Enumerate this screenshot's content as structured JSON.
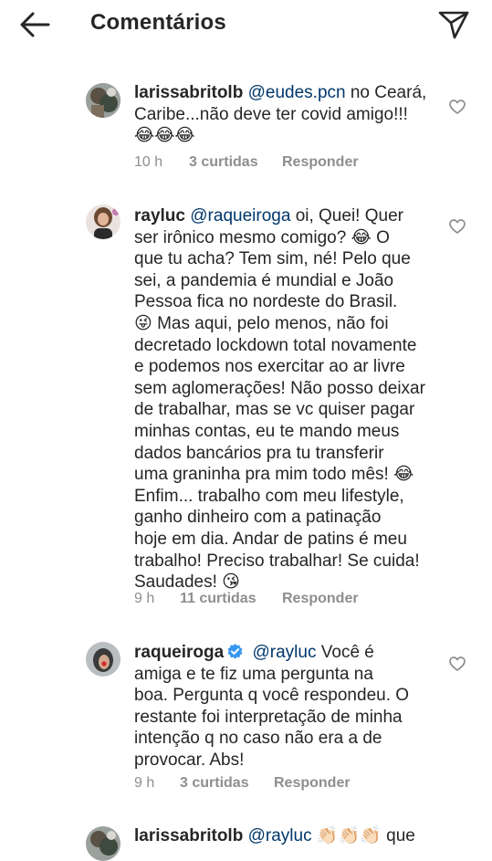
{
  "header": {
    "title": "Comentários",
    "back_icon": "arrow-left-icon",
    "send_icon": "paper-plane-icon"
  },
  "comments": [
    {
      "username": "larissabritolb",
      "mention": "@eudes.pcn",
      "text_lines": [
        "no Ceará,",
        "Caribe...não deve ter covid amigo!!!"
      ],
      "emojis": "😂😂😂",
      "time": "10 h",
      "likes": "3 curtidas",
      "reply": "Responder"
    },
    {
      "username": "rayluc",
      "mention": "@raqueiroga",
      "text_lines": [
        "oi, Quei! Quer",
        "ser irônico mesmo comigo? 😂 O",
        "que tu acha? Tem sim, né! Pelo que",
        "sei, a pandemia é mundial e João",
        "Pessoa fica no nordeste do Brasil.",
        "😜 Mas aqui, pelo menos, não foi",
        "decretado lockdown total novamente",
        "e podemos nos exercitar ao ar livre",
        "sem aglomerações! Não posso deixar",
        "de trabalhar, mas se vc quiser pagar",
        "minhas contas, eu te mando meus",
        "dados bancários pra tu transferir",
        "uma graninha pra mim todo mês! 😂",
        "Enfim... trabalho com meu lifestyle,",
        "ganho dinheiro com a patinação",
        "hoje em dia. Andar de patins é meu",
        "trabalho! Preciso trabalhar! Se cuida!",
        "Saudades! 😘"
      ],
      "time": "9 h",
      "likes": "11 curtidas",
      "reply": "Responder"
    },
    {
      "username": "raqueiroga",
      "verified": true,
      "mention": "@rayluc",
      "text_lines": [
        "Você é",
        "amiga e te fiz uma pergunta na",
        "boa. Pergunta q você respondeu. O",
        "restante foi interpretação de minha",
        "intenção q no caso não era a de",
        "provocar. Abs!"
      ],
      "time": "9 h",
      "likes": "3 curtidas",
      "reply": "Responder"
    },
    {
      "username": "larissabritolb",
      "mention": "@rayluc",
      "text_lines": [
        "👏🏻👏🏻👏🏻 que"
      ]
    }
  ],
  "colors": {
    "text": "#262626",
    "mention": "#00376b",
    "meta": "#8e8e8e",
    "verified": "#3897f0"
  }
}
